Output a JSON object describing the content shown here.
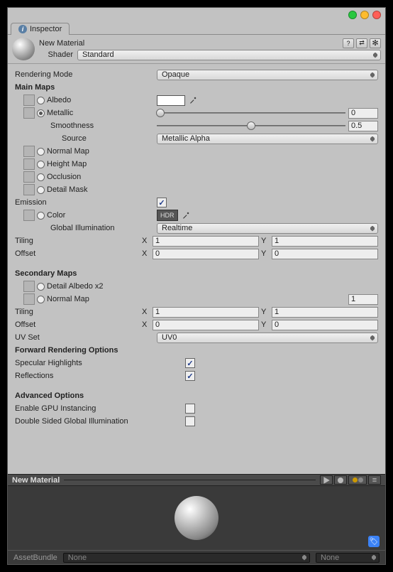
{
  "tab": "Inspector",
  "material_name": "New Material",
  "shader": {
    "label": "Shader",
    "value": "Standard"
  },
  "rendering_mode": {
    "label": "Rendering Mode",
    "value": "Opaque"
  },
  "main_maps": {
    "title": "Main Maps",
    "albedo": "Albedo",
    "metallic": "Metallic",
    "metallic_value": "0",
    "smoothness": "Smoothness",
    "smoothness_value": "0.5",
    "source": "Source",
    "source_value": "Metallic Alpha",
    "normal": "Normal Map",
    "height": "Height Map",
    "occlusion": "Occlusion",
    "detail_mask": "Detail Mask"
  },
  "emission": {
    "label": "Emission",
    "color": "Color",
    "hdr": "HDR",
    "gi": "Global Illumination",
    "gi_value": "Realtime"
  },
  "tiling": {
    "label": "Tiling",
    "x": "1",
    "y": "1"
  },
  "offset": {
    "label": "Offset",
    "x": "0",
    "y": "0"
  },
  "xy": {
    "x": "X",
    "y": "Y"
  },
  "secondary": {
    "title": "Secondary Maps",
    "detail_albedo": "Detail Albedo x2",
    "normal": "Normal Map",
    "normal_value": "1",
    "tiling": {
      "label": "Tiling",
      "x": "1",
      "y": "1"
    },
    "offset": {
      "label": "Offset",
      "x": "0",
      "y": "0"
    },
    "uv_set": {
      "label": "UV Set",
      "value": "UV0"
    }
  },
  "forward": {
    "title": "Forward Rendering Options",
    "specular": "Specular Highlights",
    "reflections": "Reflections"
  },
  "advanced": {
    "title": "Advanced Options",
    "gpu": "Enable GPU Instancing",
    "double_sided": "Double Sided Global Illumination"
  },
  "preview": {
    "title": "New Material"
  },
  "assetbundle": {
    "label": "AssetBundle",
    "value1": "None",
    "value2": "None"
  }
}
